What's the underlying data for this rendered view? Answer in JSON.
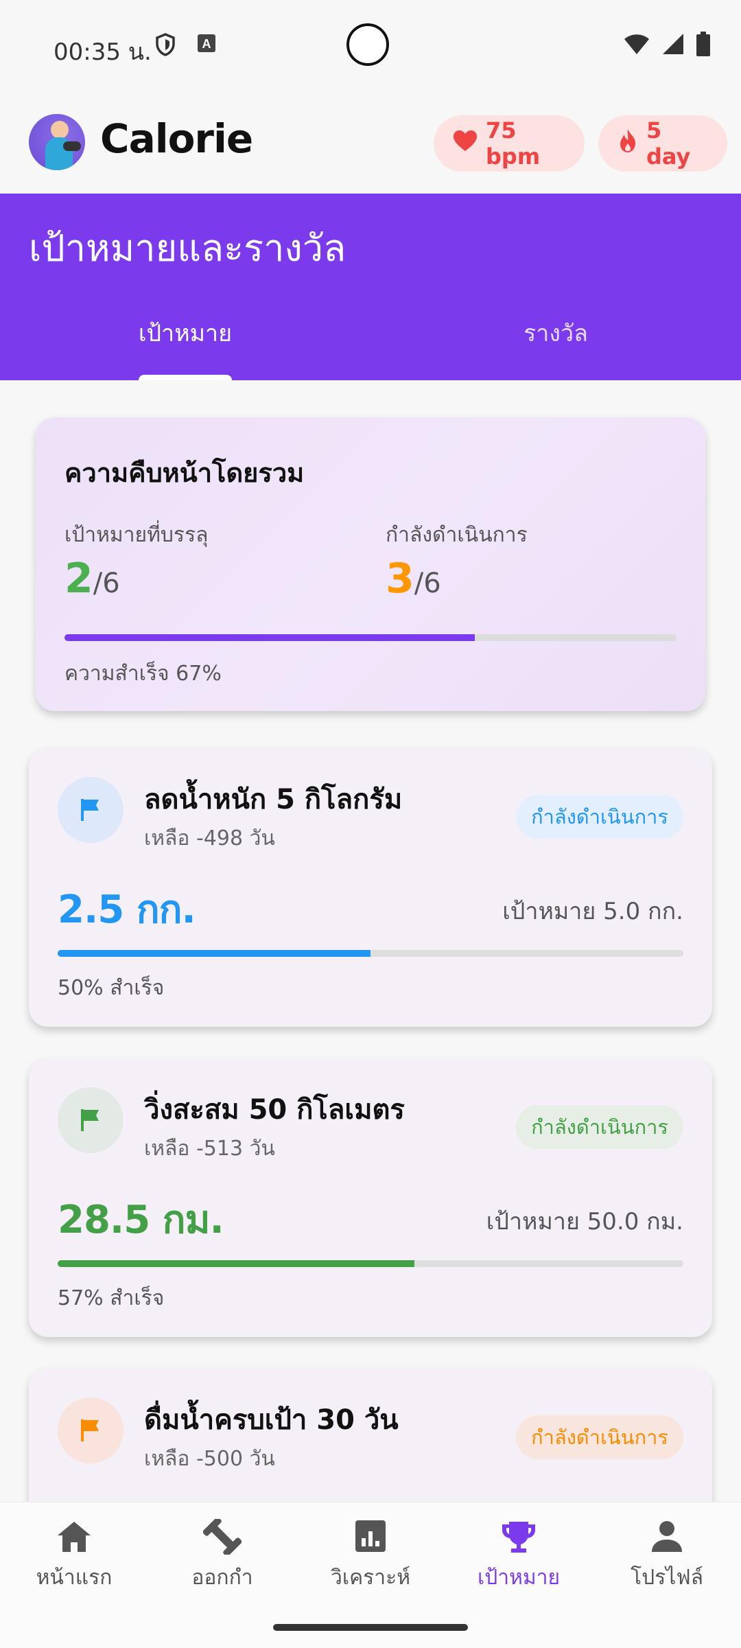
{
  "status": {
    "time": "00:35 น.",
    "left_icons": [
      "shield-icon",
      "a-badge-icon"
    ],
    "right_icons": [
      "wifi-icon",
      "signal-icon",
      "battery-icon"
    ]
  },
  "app": {
    "title": "Calorie",
    "heart_rate": "75 bpm",
    "streak": "5 day"
  },
  "header": {
    "title": "เป้าหมายและรางวัล",
    "tabs": [
      {
        "label": "เป้าหมาย",
        "active": true
      },
      {
        "label": "รางวัล",
        "active": false
      }
    ]
  },
  "summary": {
    "title": "ความคืบหน้าโดยรวม",
    "achieved_label": "เป้าหมายที่บรรลุ",
    "achieved_value": "2",
    "achieved_total": "/6",
    "in_progress_label": "กำลังดำเนินการ",
    "in_progress_value": "3",
    "in_progress_total": "/6",
    "progress_fraction": 0.67,
    "progress_text": "ความสำเร็จ 67%"
  },
  "goals": [
    {
      "title": "ลดน้ำหนัก 5 กิโลกรัม",
      "remaining": "เหลือ -498 วัน",
      "badge": "กำลังดำเนินการ",
      "current": "2.5 กก.",
      "target": "เป้าหมาย 5.0 กก.",
      "progress_fraction": 0.5,
      "percent_text": "50% สำเร็จ",
      "color": "#2196f3",
      "badge_bg": "#e3effc",
      "icon_bg": "#dde8fb",
      "icon": "flag-icon"
    },
    {
      "title": "วิ่งสะสม 50 กิโลเมตร",
      "remaining": "เหลือ -513 วัน",
      "badge": "กำลังดำเนินการ",
      "current": "28.5 กม.",
      "target": "เป้าหมาย 50.0 กม.",
      "progress_fraction": 0.57,
      "percent_text": "57% สำเร็จ",
      "color": "#43a047",
      "badge_bg": "#e6eee6",
      "icon_bg": "#e3e9e4",
      "icon": "flag-icon"
    },
    {
      "title": "ดื่มน้ำครบเป้า 30 วัน",
      "remaining": "เหลือ -500 วัน",
      "badge": "กำลังดำเนินการ",
      "current": "",
      "target": "",
      "progress_fraction": null,
      "percent_text": "",
      "color": "#fb8c00",
      "badge_bg": "#f8e6de",
      "icon_bg": "#f9e3dc",
      "icon": "flag-icon"
    }
  ],
  "nav": [
    {
      "label": "หน้าแรก",
      "icon": "home-icon",
      "active": false
    },
    {
      "label": "ออกกำ",
      "icon": "dumbbell-icon",
      "active": false
    },
    {
      "label": "วิเคราะห์",
      "icon": "analytics-icon",
      "active": false
    },
    {
      "label": "เป้าหมาย",
      "icon": "trophy-icon",
      "active": true
    },
    {
      "label": "โปรไฟล์",
      "icon": "person-icon",
      "active": false
    }
  ],
  "colors": {
    "accent": "#7c3aed",
    "achieved": "#4caf50",
    "in_progress": "#ff9800",
    "chip_text": "#ef4444"
  }
}
